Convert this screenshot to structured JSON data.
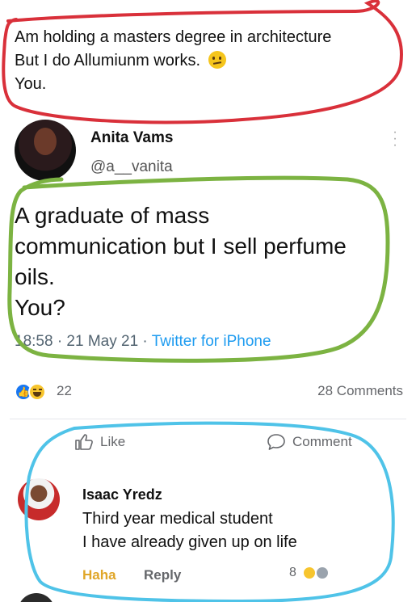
{
  "previous_post": {
    "lines": [
      "Am holding a masters degree in architecture",
      "But I do Allumiunm works.",
      "You."
    ]
  },
  "tweet": {
    "author_name": "Anita Vams",
    "author_handle": "@a__vanita",
    "body_lines": [
      "A graduate of mass",
      "communication but I sell perfume",
      "oils.",
      "You?"
    ],
    "timestamp": "18:58 · 21 May 21 · ",
    "source": "Twitter for iPhone"
  },
  "reactions": {
    "count": "22",
    "comments": "28 Comments",
    "icons": [
      "like-icon",
      "haha-icon"
    ]
  },
  "actions": {
    "like_label": "Like",
    "comment_label": "Comment"
  },
  "comment": {
    "author_name": "Isaac Yredz",
    "lines": [
      "Third year medical student",
      "I have already given up on life"
    ],
    "haha_label": "Haha",
    "reply_label": "Reply",
    "reaction_count": "8"
  },
  "colors": {
    "red_loop": "#d9303a",
    "green_loop": "#7cb342",
    "blue_loop": "#4fc3e8",
    "link": "#1d9bf0",
    "facebook_blue": "#1877f2"
  }
}
